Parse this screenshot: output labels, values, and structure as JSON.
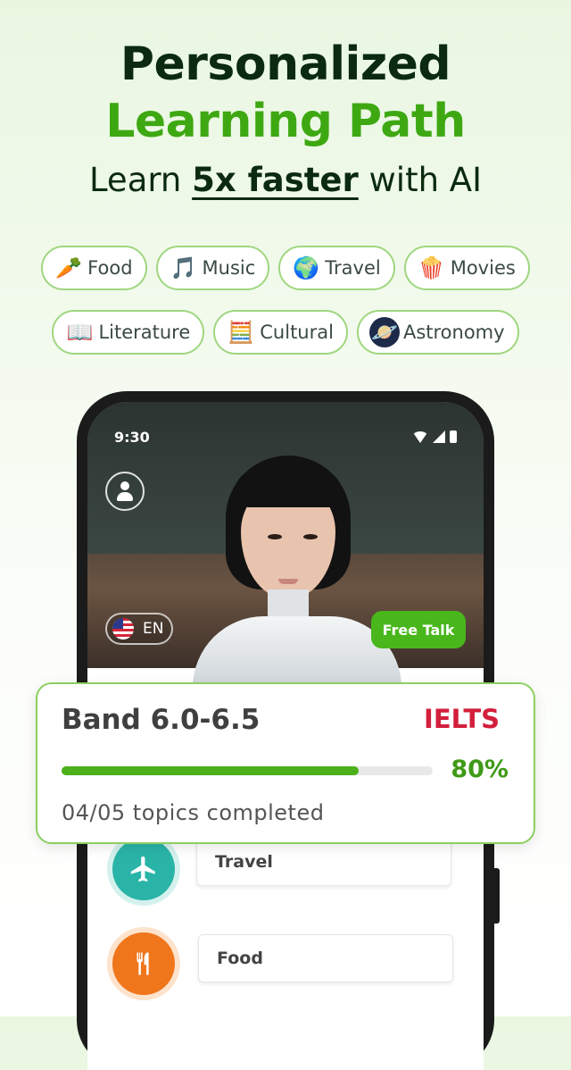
{
  "hero": {
    "title_line1": "Personalized",
    "title_line2": "Learning Path",
    "subtitle_pre": "Learn ",
    "subtitle_bold": "5x faster",
    "subtitle_post": " with AI"
  },
  "categories": [
    {
      "label": "Food",
      "icon": "carrot-icon",
      "glyph": "🥕"
    },
    {
      "label": "Music",
      "icon": "music-note-icon",
      "glyph": "🎵"
    },
    {
      "label": "Travel",
      "icon": "globe-plane-icon",
      "glyph": "🌍"
    },
    {
      "label": "Movies",
      "icon": "popcorn-film-icon",
      "glyph": "🍿"
    },
    {
      "label": "Literature",
      "icon": "book-icon",
      "glyph": "📖"
    },
    {
      "label": "Cultural",
      "icon": "abacus-icon",
      "glyph": "🧮"
    },
    {
      "label": "Astronomy",
      "icon": "planet-icon",
      "glyph": "🪐"
    }
  ],
  "phone": {
    "time": "9:30",
    "language": "EN",
    "free_talk": "Free Talk"
  },
  "progress": {
    "band": "Band 6.0-6.5",
    "exam": "IELTS",
    "percent": 0.8,
    "percent_label": "80%",
    "topics_completed": "04/05 topics completed"
  },
  "topics": [
    {
      "label": "Travel",
      "icon": "airplane-icon",
      "color": "#2ab4a8"
    },
    {
      "label": "Food",
      "icon": "fork-knife-icon",
      "color": "#f0761c"
    }
  ],
  "colors": {
    "accent_green": "#3ea812",
    "title_dark": "#0b2a10",
    "ielts_red": "#d21f3c"
  }
}
